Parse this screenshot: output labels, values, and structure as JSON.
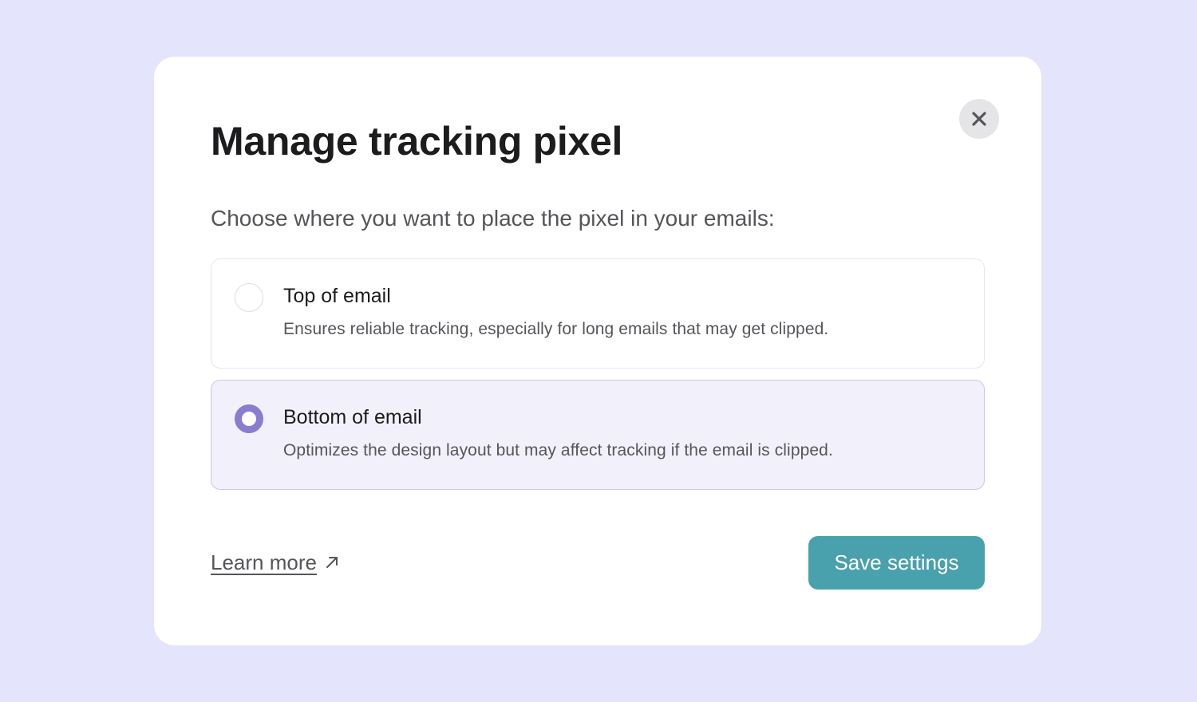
{
  "modal": {
    "title": "Manage tracking pixel",
    "subtitle": "Choose where you want to place the pixel in your emails:",
    "close_icon": "close-icon",
    "options": [
      {
        "label": "Top of email",
        "description": "Ensures reliable tracking, especially for long emails that may get clipped.",
        "selected": false
      },
      {
        "label": "Bottom of email",
        "description": "Optimizes the design layout but may affect tracking if the email is clipped.",
        "selected": true
      }
    ],
    "learn_more_label": "Learn more",
    "learn_more_icon": "external-arrow-icon",
    "save_label": "Save settings"
  },
  "colors": {
    "background": "#e4e4fc",
    "accent": "#8a7dd0",
    "button": "#4aa1ae"
  }
}
